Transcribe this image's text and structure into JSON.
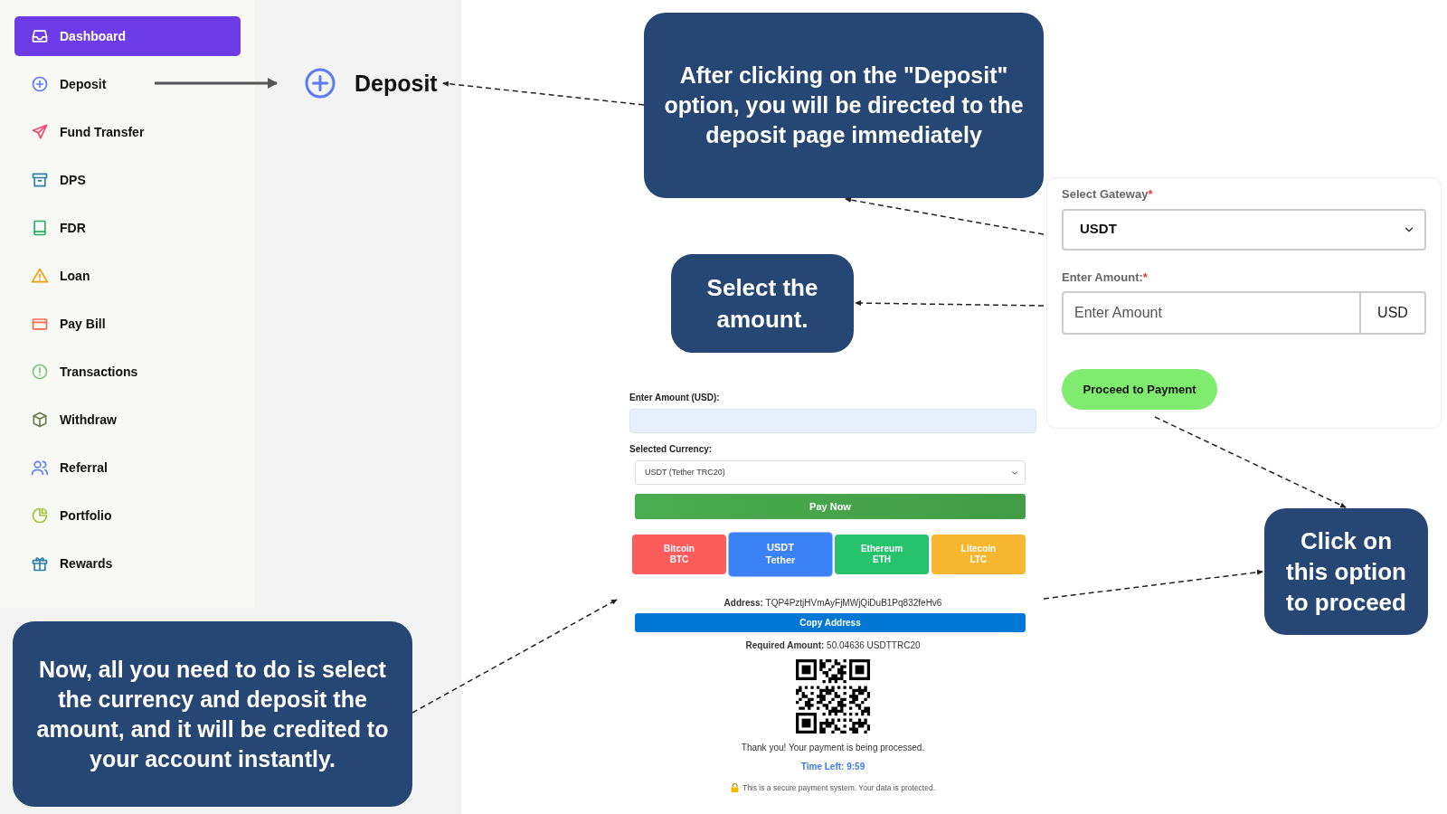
{
  "sidebar": {
    "items": [
      {
        "label": "Dashboard",
        "selected": true
      },
      {
        "label": "Deposit",
        "selected": false
      },
      {
        "label": "Fund Transfer",
        "selected": false
      },
      {
        "label": "DPS",
        "selected": false
      },
      {
        "label": "FDR",
        "selected": false
      },
      {
        "label": "Loan",
        "selected": false
      },
      {
        "label": "Pay Bill",
        "selected": false
      },
      {
        "label": "Transactions",
        "selected": false
      },
      {
        "label": "Withdraw",
        "selected": false
      },
      {
        "label": "Referral",
        "selected": false
      },
      {
        "label": "Portfolio",
        "selected": false
      },
      {
        "label": "Rewards",
        "selected": false
      }
    ]
  },
  "page_header": {
    "title": "Deposit"
  },
  "callouts": [
    "After clicking on the \"Deposit\" option, you will be directed to the deposit page immediately",
    "Select the amount.",
    "Click on this option to proceed",
    "Now, all you need to do is select the currency and deposit the amount, and it will be credited to your account instantly."
  ],
  "deposit_form": {
    "gateway_label": "Select Gateway",
    "gateway_required": "*",
    "gateway_value": "USDT",
    "amount_label": "Enter Amount:",
    "amount_required": "*",
    "amount_placeholder": "Enter Amount",
    "amount_unit": "USD",
    "submit": "Proceed to Payment"
  },
  "payment": {
    "amount_label": "Enter Amount (USD):",
    "currency_label": "Selected Currency:",
    "currency_value": "USDT (Tether TRC20)",
    "pay_button": "Pay Now",
    "currencies": [
      {
        "name": "Bitcoin",
        "code": "BTC",
        "color": "#fd5c5c",
        "selected": false
      },
      {
        "name": "USDT",
        "code": "Tether",
        "color": "#3b82f6",
        "selected": true
      },
      {
        "name": "Ethereum",
        "code": "ETH",
        "color": "#27c26c",
        "selected": false
      },
      {
        "name": "Litecoin",
        "code": "LTC",
        "color": "#f7b731",
        "selected": false
      }
    ],
    "address": "**Address:** TQP4PztjHVmAyFjMWjQiDuB1Pq832feHv6",
    "copy_button": "Copy Address",
    "required_amount": "**Required Amount:** 50.04636 USDTTRC20",
    "thanks": "Thank you! Your payment is being processed.",
    "time_left": "Time Left: 9:59",
    "secure_note": "This is a secure payment system. Your data is protected."
  }
}
